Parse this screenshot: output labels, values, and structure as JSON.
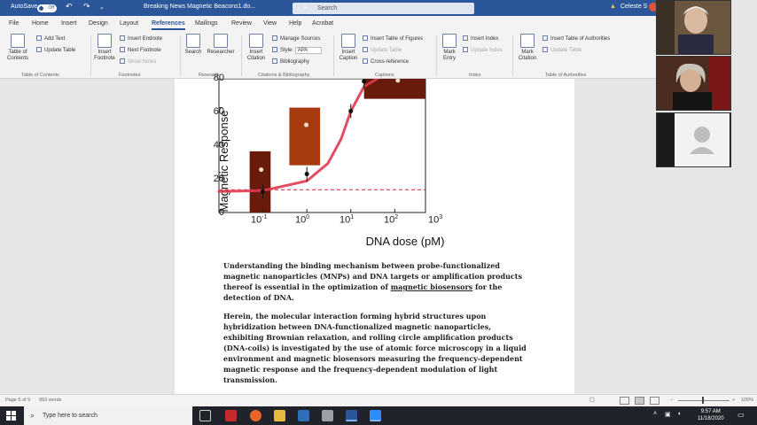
{
  "titlebar": {
    "autosave": "AutoSave",
    "autosave_state": "Off",
    "doc_title": "Breaking News Magnetic Beacons1.do...",
    "search_placeholder": "Search",
    "user": "Celeste S"
  },
  "menu": [
    "File",
    "Home",
    "Insert",
    "Design",
    "Layout",
    "References",
    "Mailings",
    "Review",
    "View",
    "Help",
    "Acrobat"
  ],
  "active_tab": "References",
  "ribbon": {
    "toc": {
      "label": "Table of Contents",
      "add_text": "Add Text",
      "update_table": "Update Table",
      "group": "Table of Contents"
    },
    "footnotes": {
      "insert_footnote": "Insert Footnote",
      "insert_endnote": "Insert Endnote",
      "next_footnote": "Next Footnote",
      "show_notes": "Show Notes",
      "group": "Footnotes"
    },
    "research": {
      "search": "Search",
      "researcher": "Researcher",
      "group": "Research"
    },
    "citations": {
      "insert_citation": "Insert Citation",
      "manage_sources": "Manage Sources",
      "style_label": "Style:",
      "style_value": "APA",
      "bibliography": "Bibliography",
      "group": "Citations & Bibliography"
    },
    "captions": {
      "insert_caption": "Insert Caption",
      "insert_tof": "Insert Table of Figures",
      "update_table": "Update Table",
      "cross_reference": "Cross-reference",
      "group": "Captions"
    },
    "index": {
      "mark_entry": "Mark Entry",
      "insert_index": "Insert Index",
      "update_index": "Update Index",
      "group": "Index"
    },
    "toa": {
      "mark_citation": "Mark Citation",
      "insert_toa": "Insert Table of Authorities",
      "update_table": "Update Table",
      "group": "Table of Authorities"
    }
  },
  "figure": {
    "ylabel": "Magnetic Response",
    "xlabel": "DNA dose (pM)",
    "yticks": [
      "0",
      "20",
      "40",
      "60",
      "80"
    ],
    "xticks": [
      {
        "b": "10",
        "e": "-1"
      },
      {
        "b": "10",
        "e": "0"
      },
      {
        "b": "10",
        "e": "1"
      },
      {
        "b": "10",
        "e": "2"
      },
      {
        "b": "10",
        "e": "3"
      }
    ]
  },
  "chart_data": {
    "type": "scatter",
    "ylabel": "Magnetic Response",
    "xlabel": "DNA dose (pM)",
    "x_scale": "log",
    "xlim": [
      0.1,
      5000
    ],
    "ylim": [
      0,
      80
    ],
    "series": [
      {
        "values": [
          {
            "x": 1,
            "y": 12
          },
          {
            "x": 10,
            "y": 22
          },
          {
            "x": 100,
            "y": 58
          },
          {
            "x": 200,
            "y": 75
          }
        ]
      }
    ],
    "fit_curve": [
      {
        "x": 0.1,
        "y": 12
      },
      {
        "x": 1,
        "y": 12.5
      },
      {
        "x": 10,
        "y": 18
      },
      {
        "x": 30,
        "y": 28
      },
      {
        "x": 60,
        "y": 42
      },
      {
        "x": 100,
        "y": 58
      },
      {
        "x": 200,
        "y": 72
      },
      {
        "x": 500,
        "y": 78
      },
      {
        "x": 2000,
        "y": 80
      }
    ],
    "baseline_y": 13,
    "grid": false
  },
  "body": {
    "p1_a": "Understanding the binding mechanism between probe-functionalized magnetic nanoparticles (MNPs) and DNA targets or amplification products thereof is essential in the optimization of ",
    "p1_link": "magnetic biosensors",
    "p1_b": " for the detection of DNA.",
    "p2": "Herein, the molecular interaction forming hybrid structures upon hybridization between DNA-functionalized magnetic nanoparticles, exhibiting Brownian relaxation, and rolling circle amplification products (DNA-coils) is investigated by the use of atomic force microscopy in a liquid environment and magnetic biosensors measuring the frequency-dependent magnetic response and the frequency-dependent modulation of light transmission."
  },
  "status": {
    "page": "Page 5 of 9",
    "words": "993 words",
    "zoom": "100%"
  },
  "taskbar": {
    "search_placeholder": "Type here to search",
    "time": "9:57 AM",
    "date": "11/18/2020"
  },
  "colors": {
    "word_blue": "#2b579a",
    "curve": "#e03a50",
    "afm_dark": "#6a1a0a",
    "afm_mid": "#a83a10"
  }
}
